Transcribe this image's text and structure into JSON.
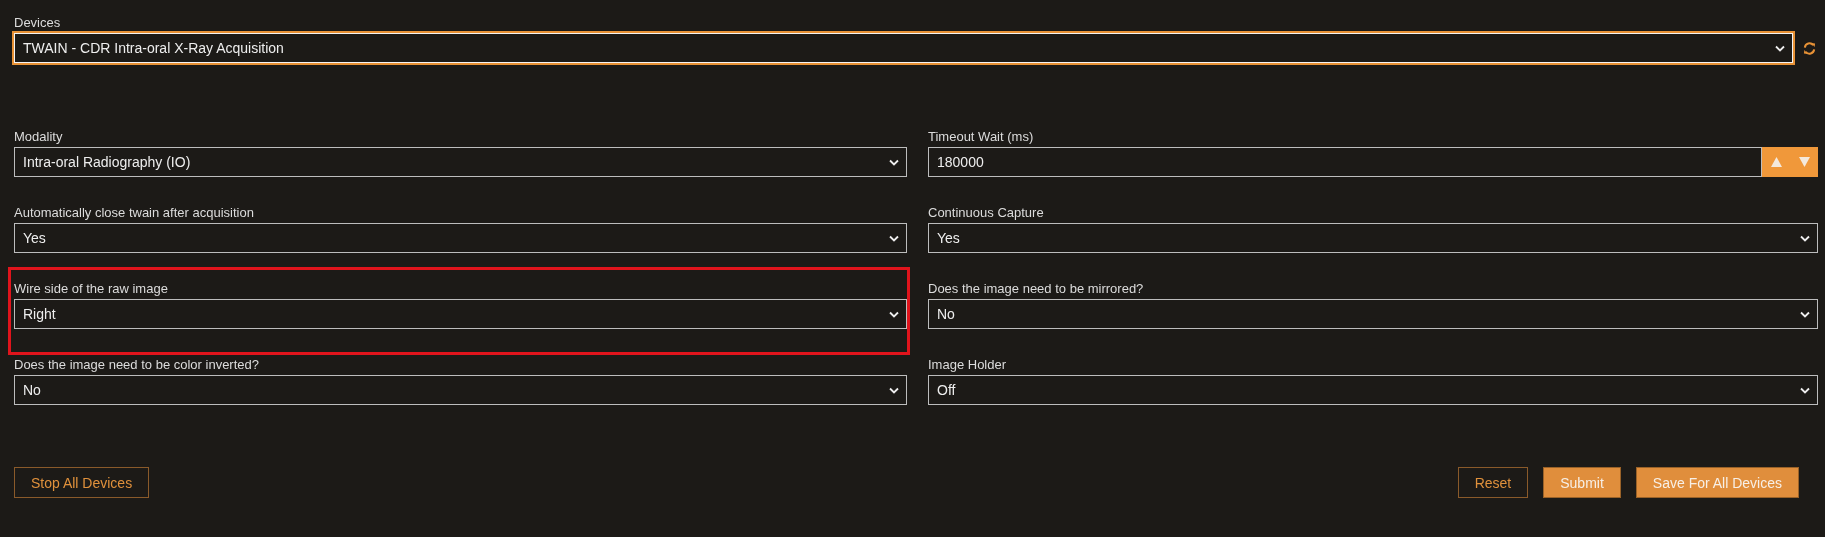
{
  "device": {
    "label": "Devices",
    "value": "TWAIN - CDR Intra-oral X-Ray Acquisition",
    "focused": true
  },
  "fields": [
    {
      "label": "Modality",
      "value": "Intra-oral Radiography (IO)",
      "kind": "select",
      "highlighted": false
    },
    {
      "label": "Timeout Wait (ms)",
      "value": "180000",
      "kind": "number",
      "highlighted": false
    },
    {
      "label": "Automatically close twain after acquisition",
      "value": "Yes",
      "kind": "select",
      "highlighted": false
    },
    {
      "label": "Continuous Capture",
      "value": "Yes",
      "kind": "select",
      "highlighted": false
    },
    {
      "label": "Wire side of the raw image",
      "value": "Right",
      "kind": "select",
      "highlighted": true
    },
    {
      "label": "Does the image need to be mirrored?",
      "value": "No",
      "kind": "select",
      "highlighted": false
    },
    {
      "label": "Does the image need to be color inverted?",
      "value": "No",
      "kind": "select",
      "highlighted": false
    },
    {
      "label": "Image Holder",
      "value": "Off",
      "kind": "select",
      "highlighted": false
    }
  ],
  "buttons_left": [
    {
      "label": "Stop All Devices",
      "kind": "outline"
    }
  ],
  "buttons_right": [
    {
      "label": "Reset",
      "kind": "outline"
    },
    {
      "label": "Submit",
      "kind": "filled"
    },
    {
      "label": "Save For All Devices",
      "kind": "filled"
    }
  ]
}
